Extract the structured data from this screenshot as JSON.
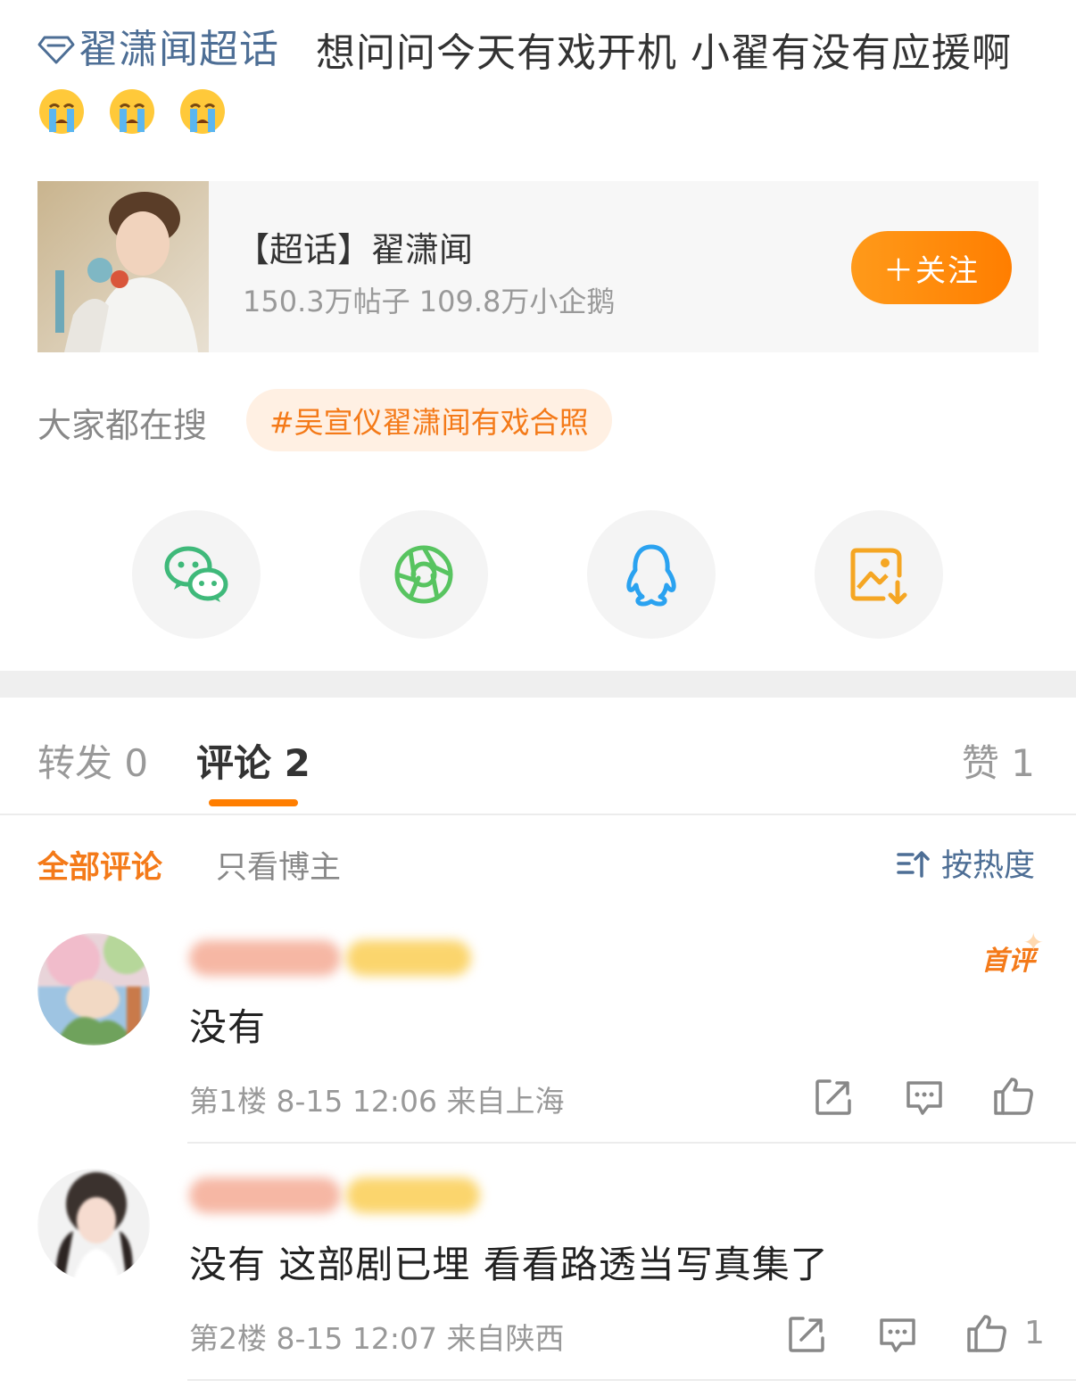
{
  "post": {
    "topic_link": "翟潇闻超话",
    "text": "想问问今天有戏开机 小翟有没有应援啊",
    "emojis": [
      "crying-emoji",
      "crying-emoji",
      "crying-emoji"
    ]
  },
  "topic_card": {
    "title": "【超话】翟潇闻",
    "stats": "150.3万帖子 109.8万小企鹅",
    "follow_label": "＋关注"
  },
  "hot_search": {
    "label": "大家都在搜",
    "tag": "#吴宣仪翟潇闻有戏合照"
  },
  "share": {
    "icons": [
      "wechat-icon",
      "moments-icon",
      "qq-icon",
      "save-image-icon"
    ]
  },
  "tabs": {
    "repost": "转发 0",
    "comments": "评论 2",
    "likes": "赞 1"
  },
  "filters": {
    "all": "全部评论",
    "blogger_only": "只看博主",
    "sort": "按热度"
  },
  "comments": [
    {
      "badge": "首评",
      "text": "没有",
      "meta": "第1楼 8-15 12:06 来自上海",
      "likes": ""
    },
    {
      "badge": "",
      "text": "没有 这部剧已埋  看看路透当写真集了",
      "meta": "第2楼 8-15 12:07 来自陕西",
      "likes": "1"
    }
  ],
  "colors": {
    "accent_orange": "#ff7e00",
    "link_blue": "#4d6e95",
    "text_gray": "#999999"
  }
}
